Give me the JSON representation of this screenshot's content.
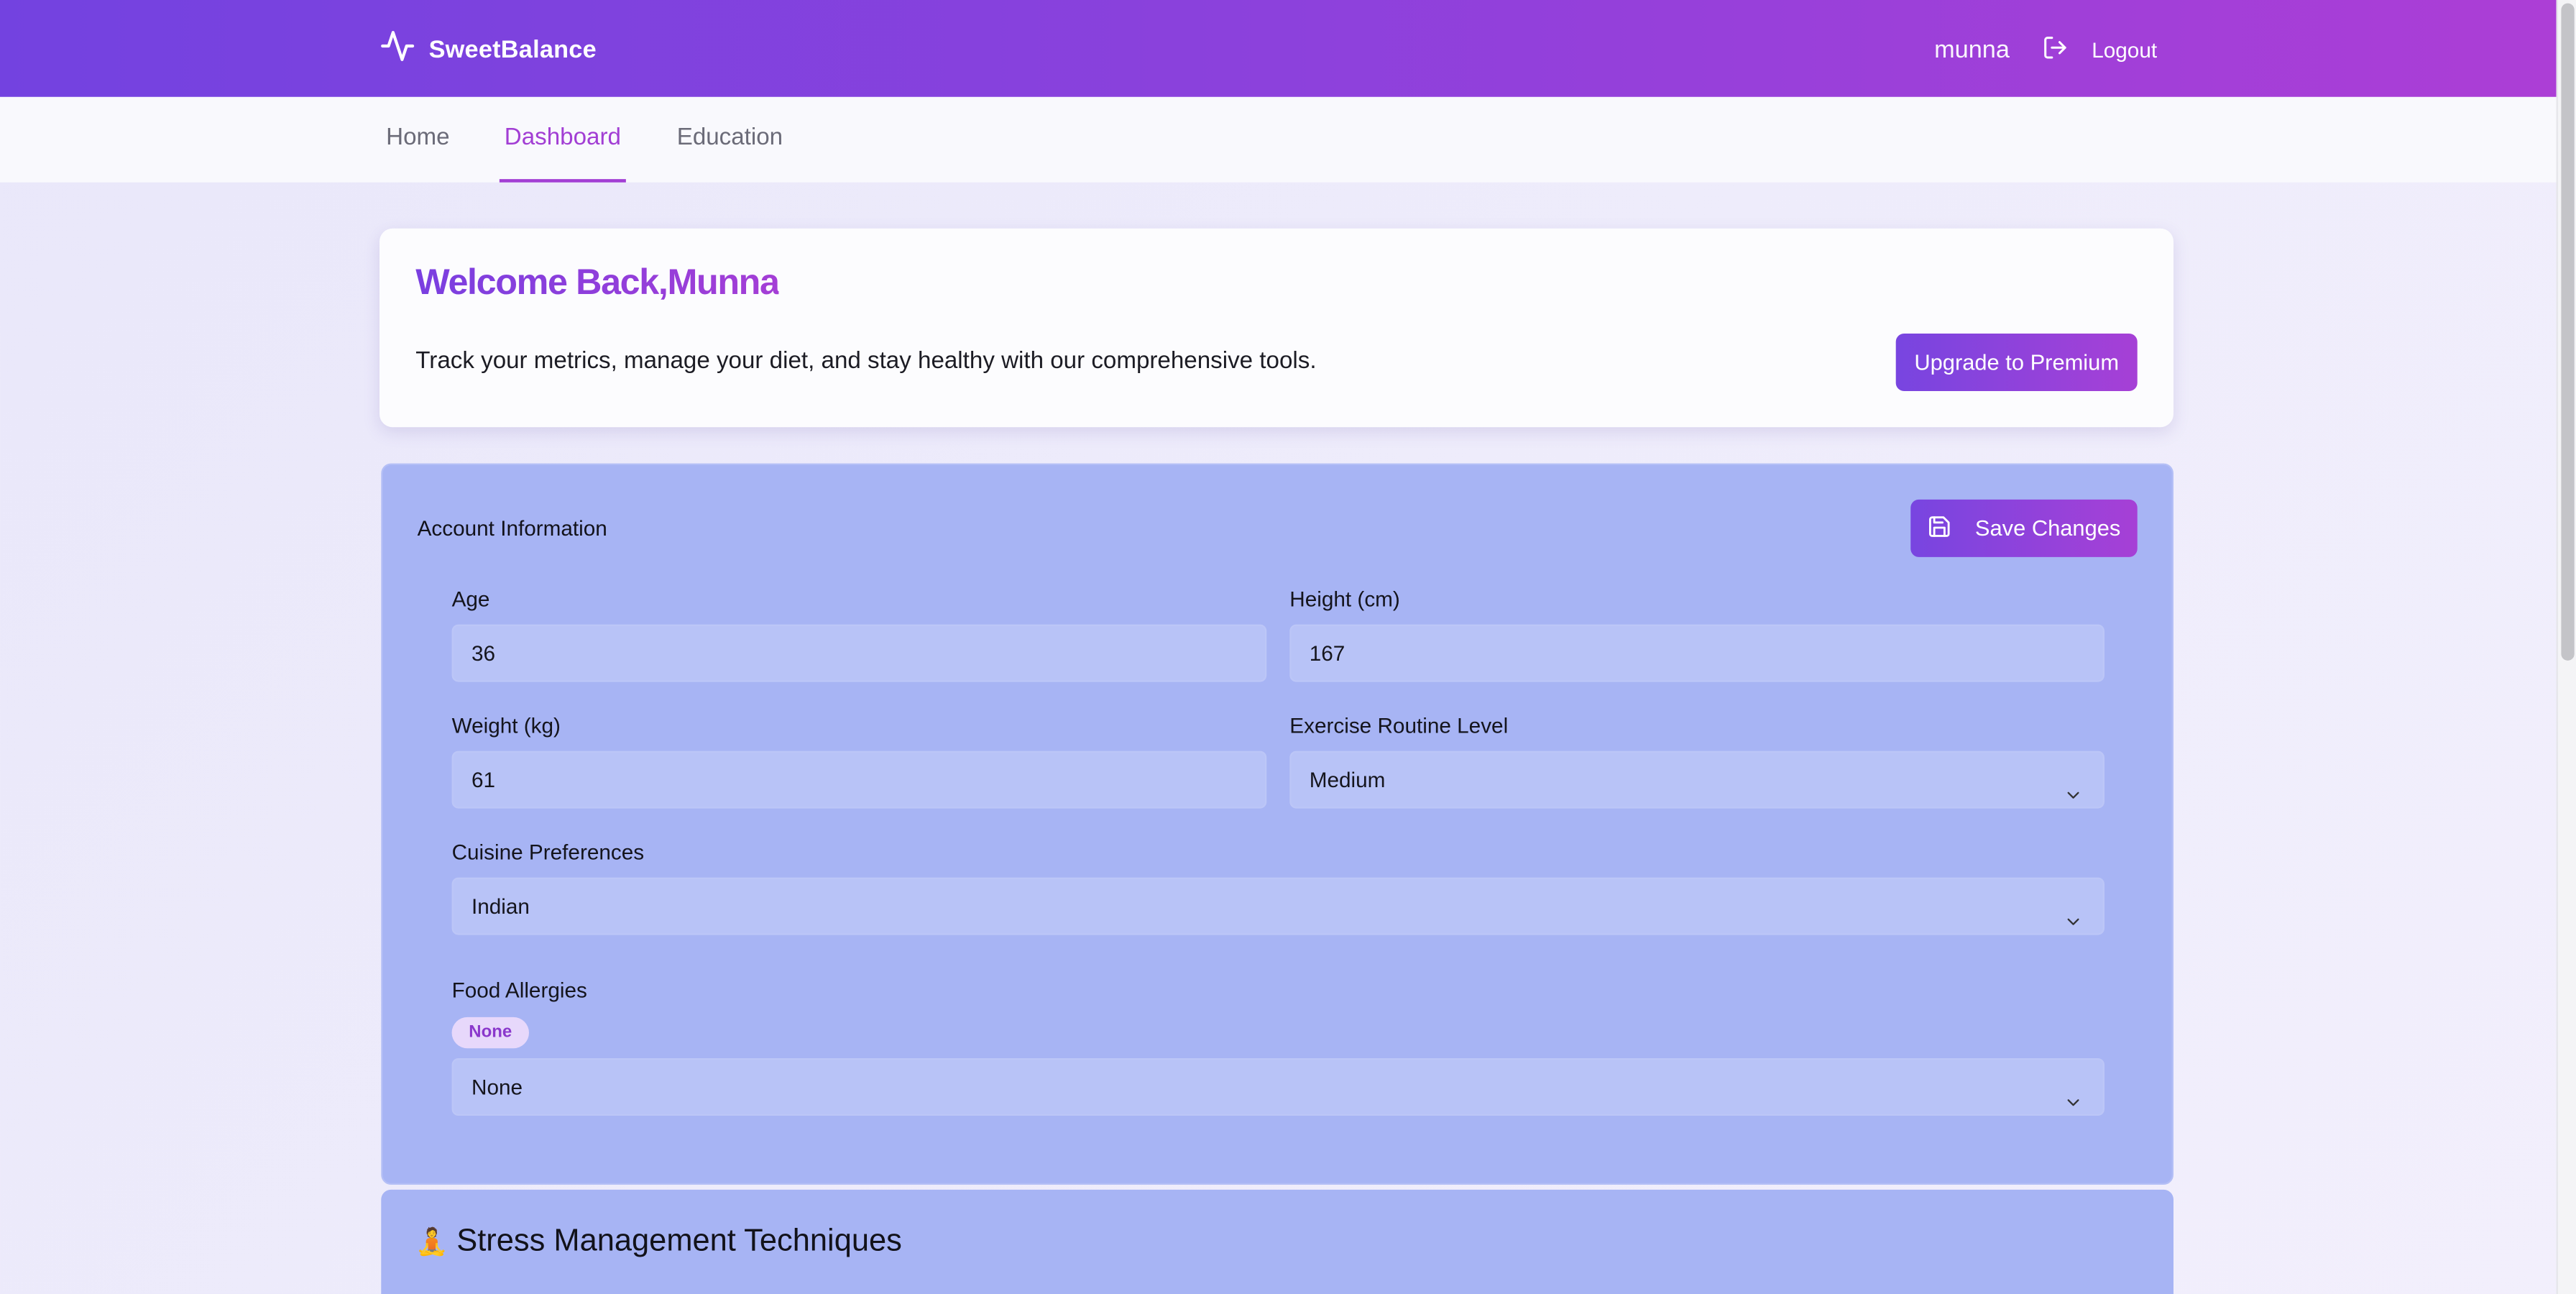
{
  "app": {
    "brand_name": "SweetBalance",
    "username": "munna",
    "logout_label": "Logout"
  },
  "nav": {
    "tabs": [
      {
        "label": "Home",
        "active": false
      },
      {
        "label": "Dashboard",
        "active": true
      },
      {
        "label": "Education",
        "active": false
      }
    ]
  },
  "welcome": {
    "title": "Welcome Back,Munna",
    "text": "Track your metrics, manage your diet, and stay healthy with our comprehensive tools.",
    "upgrade_label": "Upgrade to Premium"
  },
  "account": {
    "title": "Account Information",
    "save_label": "Save Changes",
    "age": {
      "label": "Age",
      "value": "36"
    },
    "height": {
      "label": "Height (cm)",
      "value": "167"
    },
    "weight": {
      "label": "Weight (kg)",
      "value": "61"
    },
    "exercise": {
      "label": "Exercise Routine Level",
      "value": "Medium"
    },
    "cuisine": {
      "label": "Cuisine Preferences",
      "value": "Indian"
    },
    "allergies": {
      "label": "Food Allergies",
      "badge": "None",
      "value": "None"
    }
  },
  "stress": {
    "emoji": "🧘",
    "title": "Stress Management Techniques"
  },
  "icons": {
    "brand": "heartbeat-pulse-icon",
    "logout": "logout-icon",
    "save": "floppy-disk-icon",
    "dropdown": "chevron-down-icon"
  },
  "colors": {
    "header_gradient_start": "#7342e0",
    "header_gradient_end": "#ac3ed6",
    "accent": "#a23ed4",
    "card_blue": "#a7b4f4",
    "field_blue": "#b8c3f7"
  }
}
